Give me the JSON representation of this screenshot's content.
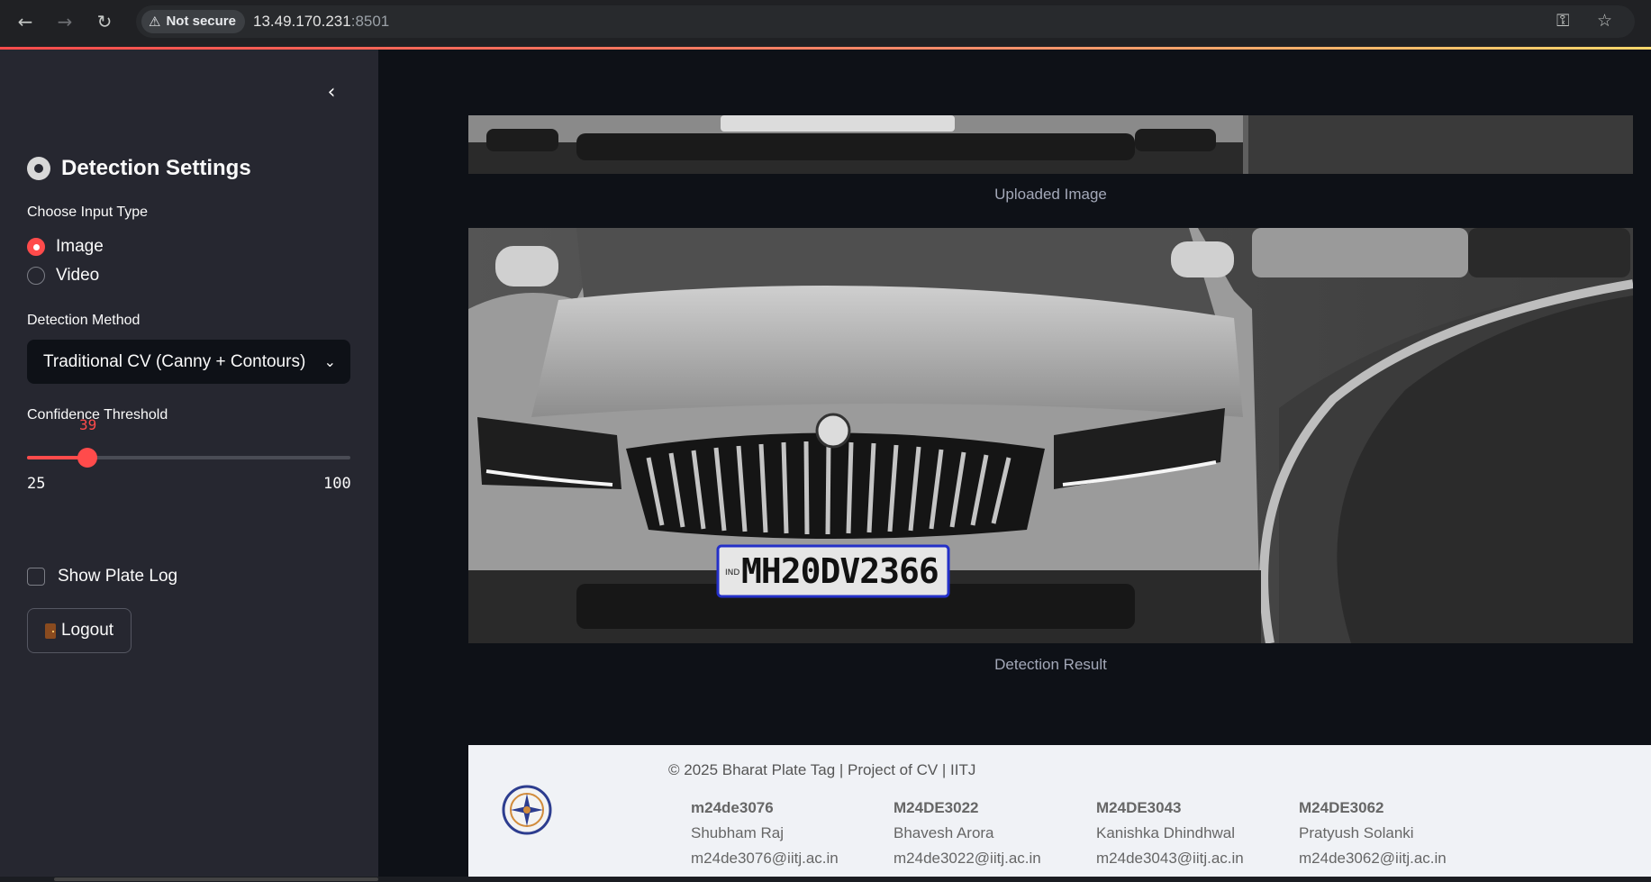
{
  "browser": {
    "security_label": "Not secure",
    "url_host": "13.49.170.231",
    "url_port": ":8501",
    "icons": [
      "back-icon",
      "forward-icon",
      "reload-icon",
      "warning-icon",
      "key-icon",
      "star-icon"
    ]
  },
  "sidebar": {
    "title": "Detection Settings",
    "input_type_label": "Choose Input Type",
    "input_options": [
      "Image",
      "Video"
    ],
    "selected_input": "Image",
    "method_label": "Detection Method",
    "method_value": "Traditional CV (Canny + Contours)",
    "threshold_label": "Confidence Threshold",
    "threshold_value": "39",
    "threshold_min": "25",
    "threshold_max": "100",
    "show_log_label": "Show Plate Log",
    "show_log_checked": false,
    "logout_label": "Logout"
  },
  "main": {
    "uploaded_caption": "Uploaded Image",
    "result_caption": "Detection Result",
    "plate_text": "MH20DV2366",
    "plate_country": "IND"
  },
  "footer": {
    "copyright": "© 2025 Bharat Plate Tag | Project of CV | IITJ",
    "members": [
      {
        "id": "m24de3076",
        "name": "Shubham Raj",
        "email": "m24de3076@iitj.ac.in"
      },
      {
        "id": "M24DE3022",
        "name": "Bhavesh Arora",
        "email": "m24de3022@iitj.ac.in"
      },
      {
        "id": "M24DE3043",
        "name": "Kanishka Dhindhwal",
        "email": "m24de3043@iitj.ac.in"
      },
      {
        "id": "M24DE3062",
        "name": "Pratyush Solanki",
        "email": "m24de3062@iitj.ac.in"
      }
    ]
  },
  "colors": {
    "accent": "#ff4b4b",
    "plate_box": "#2430c8",
    "bg": "#0e1117",
    "sidebar": "#262730"
  }
}
